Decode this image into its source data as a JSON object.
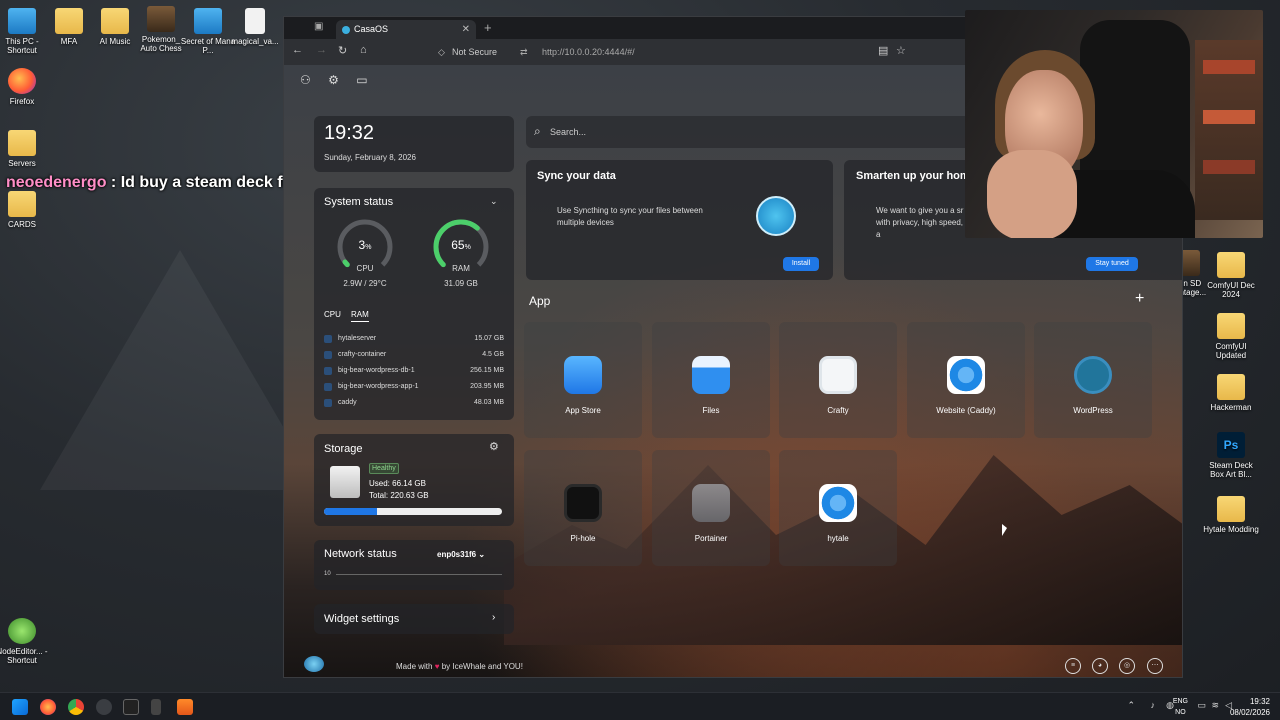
{
  "desktop": {
    "left_icons": [
      {
        "label": "This PC - Shortcut",
        "icon": "pc-icon"
      },
      {
        "label": "MFA",
        "icon": "folder-icon"
      },
      {
        "label": "AI Music",
        "icon": "folder-icon"
      },
      {
        "label": "Pokemon_ Auto Chess",
        "icon": "app-icon"
      },
      {
        "label": "Secret of Mana P...",
        "icon": "app-icon"
      },
      {
        "label": "magical_va...",
        "icon": "document-icon"
      },
      {
        "label": "Firefox",
        "icon": "firefox-icon"
      },
      {
        "label": "Servers",
        "icon": "folder-icon"
      },
      {
        "label": "CARDS",
        "icon": "folder-icon"
      },
      {
        "label": "NodeEditor... - Shortcut",
        "icon": "node-editor-icon"
      }
    ],
    "right_icons": [
      {
        "label": "ComfyUI Dec 2024",
        "icon": "folder-icon"
      },
      {
        "label": "ComfyUI Updated",
        "icon": "folder-icon"
      },
      {
        "label": "Hackerman",
        "icon": "folder-icon"
      },
      {
        "label": "Steam Deck Box Art Bl...",
        "icon": "photoshop-icon"
      },
      {
        "label": "Hytale Modding",
        "icon": "folder-icon"
      }
    ],
    "partial_right_label": "on SD ontage..."
  },
  "chat": {
    "user": "neoedenergo",
    "separator": " : ",
    "message": "Id buy a steam deck first"
  },
  "browser": {
    "tab_title": "CasaOS",
    "not_secure": "Not Secure",
    "url": "http://10.0.0.20:4444/#/"
  },
  "casa": {
    "clock": {
      "time": "19:32",
      "date": "Sunday, February 8, 2026"
    },
    "system_status": {
      "title": "System status",
      "cpu": {
        "value": "3",
        "unit": "%",
        "label": "CPU",
        "sub": "2.9W / 29°C",
        "percent": 3
      },
      "ram": {
        "value": "65",
        "unit": "%",
        "label": "RAM",
        "sub": "31.09 GB",
        "percent": 65
      },
      "tabs": [
        "CPU",
        "RAM"
      ],
      "active_tab": "RAM",
      "processes": [
        {
          "name": "hytaleserver",
          "value": "15.07 GB"
        },
        {
          "name": "crafty-container",
          "value": "4.5 GB"
        },
        {
          "name": "big-bear-wordpress-db-1",
          "value": "256.15 MB"
        },
        {
          "name": "big-bear-wordpress-app-1",
          "value": "203.95 MB"
        },
        {
          "name": "caddy",
          "value": "48.03 MB"
        }
      ]
    },
    "storage": {
      "title": "Storage",
      "badge": "Healthy",
      "used": "Used: 66.14 GB",
      "total": "Total: 220.63 GB",
      "percent": 30
    },
    "network": {
      "title": "Network status",
      "interface": "enp0s31f6",
      "axis_value": "10"
    },
    "widget_settings": "Widget settings",
    "search": {
      "placeholder": "Search..."
    },
    "cards": [
      {
        "title": "Sync your data",
        "text": "Use Syncthing to sync your files between multiple devices",
        "button": "Install"
      },
      {
        "title": "Smarten up your hom",
        "text": "We want to give you a sr with privacy, high speed, a",
        "button": "Stay tuned"
      }
    ],
    "apps_title": "App",
    "apps": [
      {
        "name": "App Store",
        "icon": "app-store-icon",
        "color": "#3aa0f0"
      },
      {
        "name": "Files",
        "icon": "files-icon",
        "color": "#2f8ff0"
      },
      {
        "name": "Crafty",
        "icon": "crafty-icon",
        "color": "#f4f6f8"
      },
      {
        "name": "Website (Caddy)",
        "icon": "caddy-icon",
        "color": "#1e88e5"
      },
      {
        "name": "WordPress",
        "icon": "wordpress-icon",
        "color": "#21759b"
      },
      {
        "name": "Pi-hole",
        "icon": "pihole-icon",
        "color": "#111111"
      },
      {
        "name": "Portainer",
        "icon": "portainer-icon",
        "color": "#9aa2ab"
      },
      {
        "name": "hytale",
        "icon": "hytale-icon",
        "color": "#1e88e5"
      }
    ],
    "footer": {
      "prefix": "Made with",
      "suffix": "by IceWhale and YOU!"
    }
  },
  "taskbar": {
    "lang_top": "ENG",
    "lang_bottom": "NO",
    "time": "19:32",
    "date": "08/02/2026"
  }
}
